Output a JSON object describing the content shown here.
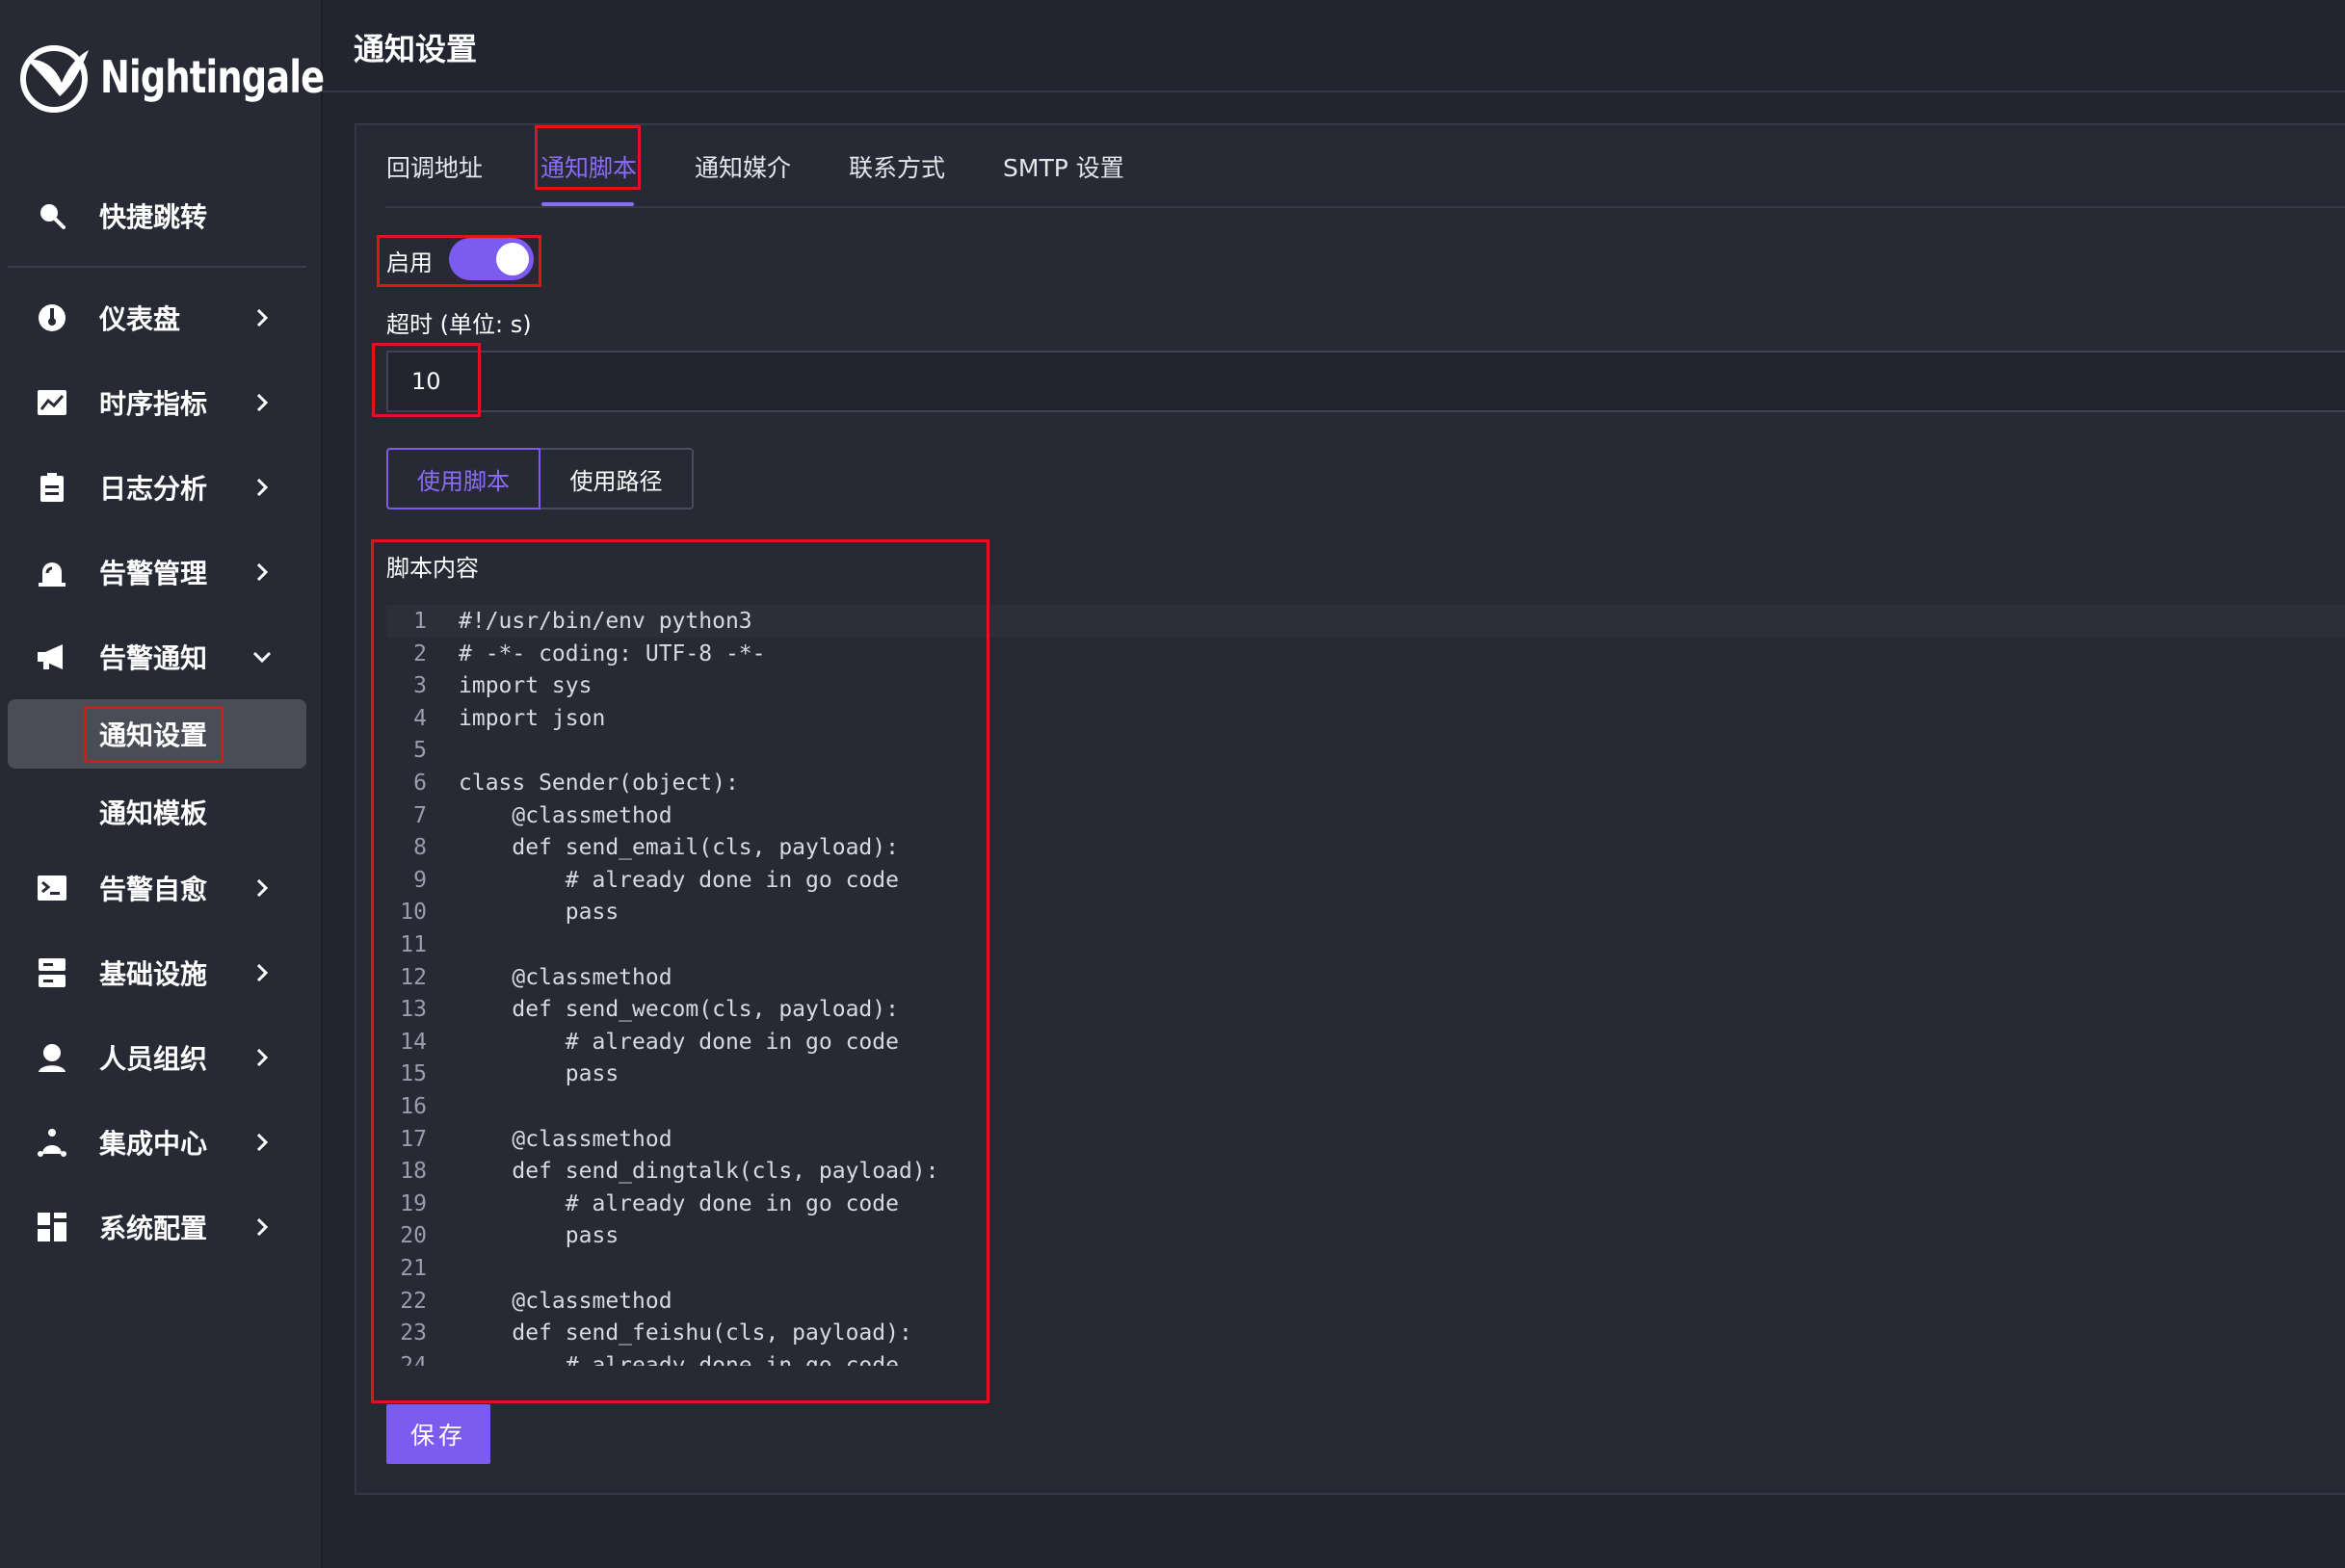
{
  "app": {
    "name": "Nightingale"
  },
  "sidebar": {
    "quick_jump": "快捷跳转",
    "items": [
      {
        "label": "仪表盘",
        "icon": "dashboard-icon"
      },
      {
        "label": "时序指标",
        "icon": "line-chart-icon"
      },
      {
        "label": "日志分析",
        "icon": "log-icon"
      },
      {
        "label": "告警管理",
        "icon": "alarm-icon"
      },
      {
        "label": "告警通知",
        "icon": "megaphone-icon"
      },
      {
        "label": "告警自愈",
        "icon": "terminal-icon"
      },
      {
        "label": "基础设施",
        "icon": "server-icon"
      },
      {
        "label": "人员组织",
        "icon": "user-icon"
      },
      {
        "label": "集成中心",
        "icon": "integration-icon"
      },
      {
        "label": "系统配置",
        "icon": "grid-icon"
      }
    ],
    "sub_items": [
      {
        "label": "通知设置",
        "active": true
      },
      {
        "label": "通知模板",
        "active": false
      }
    ]
  },
  "page": {
    "title": "通知设置"
  },
  "tabs": [
    {
      "label": "回调地址"
    },
    {
      "label": "通知脚本",
      "active": true
    },
    {
      "label": "通知媒介"
    },
    {
      "label": "联系方式"
    },
    {
      "label": "SMTP 设置"
    }
  ],
  "form": {
    "enable_label": "启用",
    "enabled": true,
    "timeout_label": "超时 (单位: s)",
    "timeout_value": "10",
    "mode_options": [
      "使用脚本",
      "使用路径"
    ],
    "mode_selected": "使用脚本",
    "script_label": "脚本内容",
    "save_label": "保存"
  },
  "code": {
    "lines": [
      "#!/usr/bin/env python3",
      "# -*- coding: UTF-8 -*-",
      "import sys",
      "import json",
      "",
      "class Sender(object):",
      "    @classmethod",
      "    def send_email(cls, payload):",
      "        # already done in go code",
      "        pass",
      "",
      "    @classmethod",
      "    def send_wecom(cls, payload):",
      "        # already done in go code",
      "        pass",
      "",
      "    @classmethod",
      "    def send_dingtalk(cls, payload):",
      "        # already done in go code",
      "        pass",
      "",
      "    @classmethod",
      "    def send_feishu(cls, payload):",
      "        # already done in go code"
    ]
  },
  "colors": {
    "accent": "#7c5cf0",
    "background": "#22252f",
    "sidebar": "#272a35",
    "highlight_box": "#e0141e"
  }
}
